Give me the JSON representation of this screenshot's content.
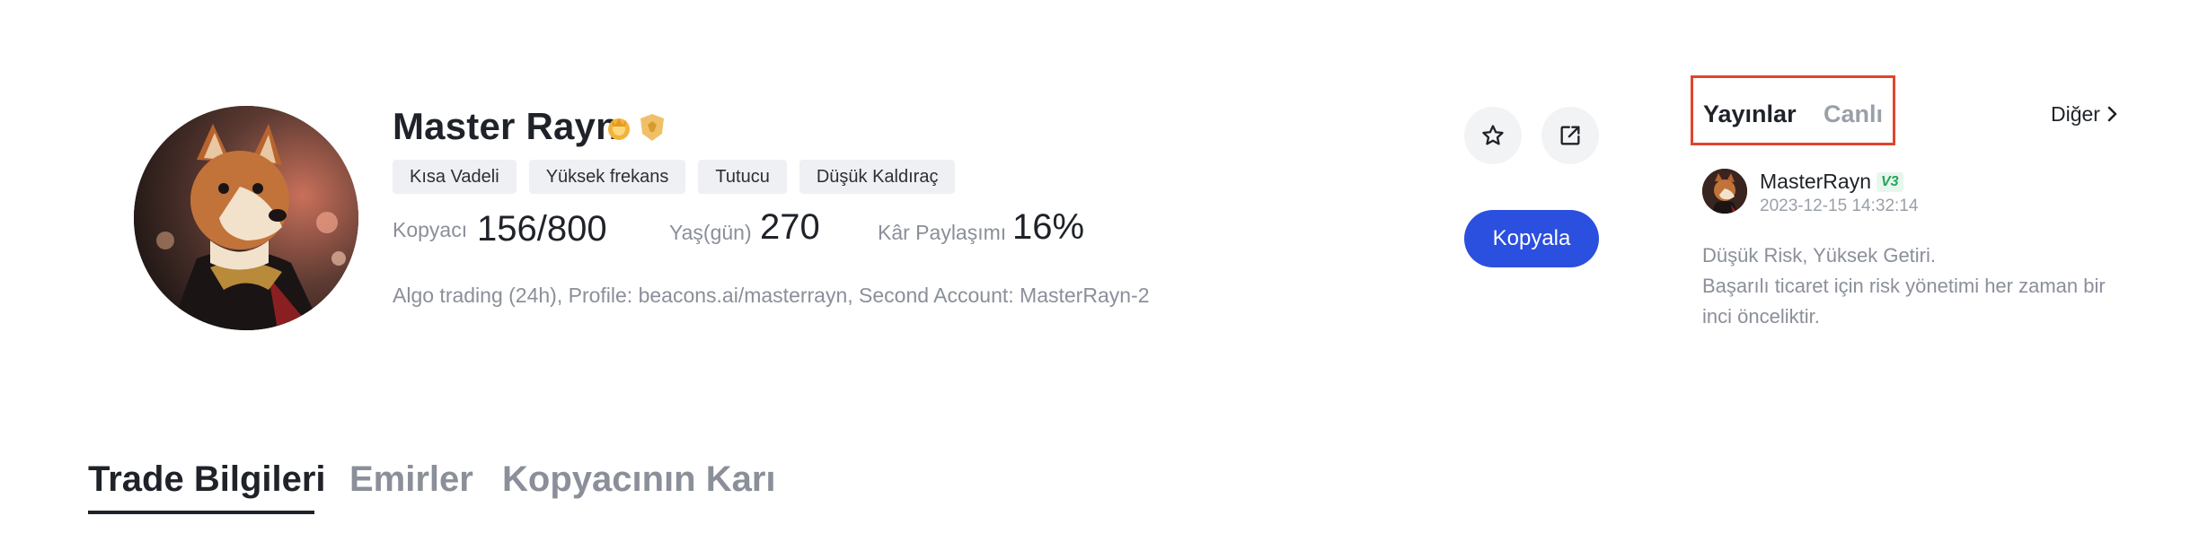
{
  "profile": {
    "name": "Master Rayn",
    "tags": [
      "Kısa Vadeli",
      "Yüksek frekans",
      "Tutucu",
      "Düşük Kaldıraç"
    ],
    "stats": {
      "copiers_label": "Kopyacı",
      "copiers_value": "156/800",
      "age_label": "Yaş(gün)",
      "age_value": "270",
      "profit_share_label": "Kâr Paylaşımı",
      "profit_share_value": "16%"
    },
    "description": "Algo trading (24h), Profile: beacons.ai/masterrayn, Second Account: MasterRayn-2"
  },
  "actions": {
    "favorite_icon": "star-icon",
    "share_icon": "external-link-icon",
    "copy_label": "Kopyala",
    "accent_color": "#2b4fde"
  },
  "posts_panel": {
    "tabs": [
      "Yayınlar",
      "Canlı"
    ],
    "more_label": "Diğer",
    "post": {
      "username": "MasterRayn",
      "level_badge": "V3",
      "timestamp": "2023-12-15 14:32:14",
      "line1": "Düşük Risk, Yüksek Getiri.",
      "line2": "Başarılı ticaret için risk yönetimi her zaman bir inci önceliktir."
    }
  },
  "bottom_tabs": [
    "Trade Bilgileri",
    "Emirler",
    "Kopyacının Karı"
  ]
}
